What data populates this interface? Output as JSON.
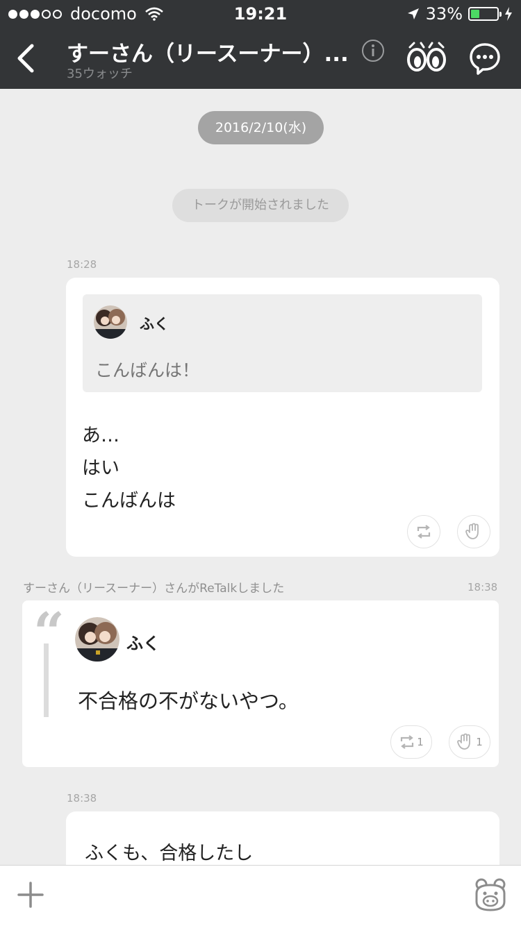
{
  "status_bar": {
    "carrier": "docomo",
    "time": "19:21",
    "battery": "33%",
    "battery_level": 0.33,
    "signal_bars": 3
  },
  "nav": {
    "title": "すーさん（リースーナー）...",
    "subtitle": "35ウォッチ",
    "icons": [
      "back-icon",
      "info-icon",
      "watch-eyes-icon",
      "chat-bubble-icon"
    ]
  },
  "feed": {
    "date_pill": "2016/2/10(水)",
    "start_notice": "トークが開始されました",
    "messages": [
      {
        "time": "18:28",
        "quote": {
          "author": "ふく",
          "text": "こんばんは！"
        },
        "lines": [
          "あ…",
          "はい",
          "こんばんは"
        ]
      },
      {
        "retalk_header": "すーさん（リースーナー）さんがReTalkしました",
        "time": "18:38",
        "author": "ふく",
        "text": "不合格の不がないやつ。",
        "retalk_count": "1",
        "like_count": "1"
      },
      {
        "time": "18:38",
        "lines": [
          "ふくも、合格したし"
        ]
      }
    ]
  },
  "accent": {
    "topbar": "#333537",
    "background": "#ededed",
    "battery_green": "#4cd964"
  }
}
